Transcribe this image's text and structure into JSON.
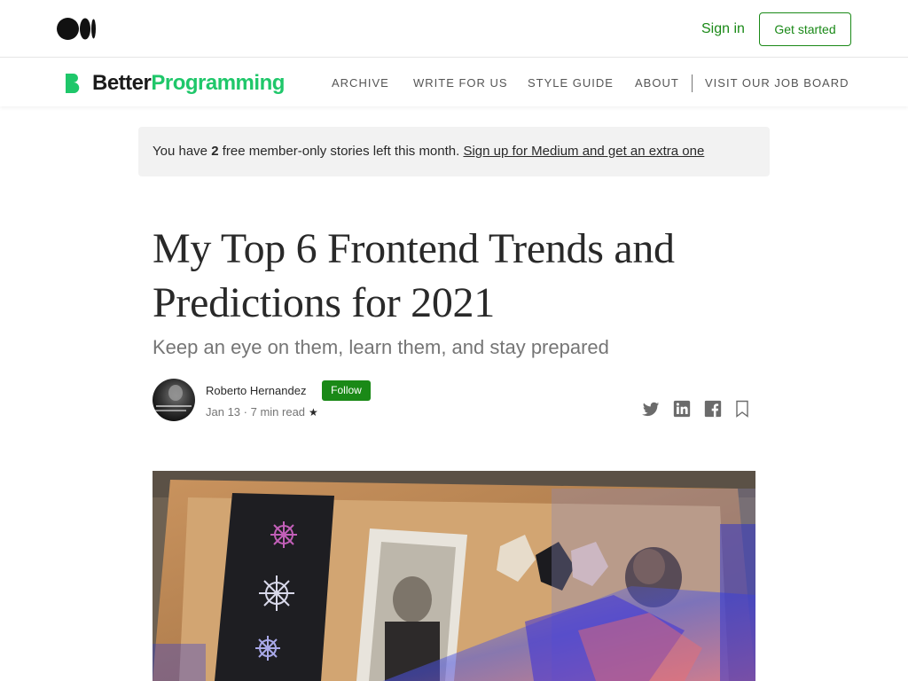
{
  "topbar": {
    "logo_icon": "medium-logo-icon",
    "signin_label": "Sign in",
    "get_started_label": "Get started",
    "accent_color": "#1a8917"
  },
  "publication": {
    "name_part1": "Better",
    "name_part2": "Programming",
    "name_color": "#1fc76a",
    "nav": [
      {
        "label": "ARCHIVE"
      },
      {
        "label": "WRITE FOR US"
      },
      {
        "label": "STYLE GUIDE"
      },
      {
        "label": "ABOUT"
      },
      {
        "label": "VISIT OUR JOB BOARD"
      }
    ]
  },
  "banner": {
    "prefix": "You have ",
    "count": "2",
    "suffix": " free member-only stories left this month. ",
    "link_label": "Sign up for Medium and get an extra one"
  },
  "article": {
    "title": "My Top 6 Frontend Trends and Predictions for 2021",
    "subtitle": "Keep an eye on them, learn them, and stay prepared",
    "author": "Roberto Hernandez",
    "follow_label": "Follow",
    "date": "Jan 13",
    "separator": " · ",
    "read_time": "7 min read",
    "star": "★",
    "share_icons": [
      "twitter-icon",
      "linkedin-icon",
      "facebook-icon",
      "bookmark-icon"
    ]
  }
}
